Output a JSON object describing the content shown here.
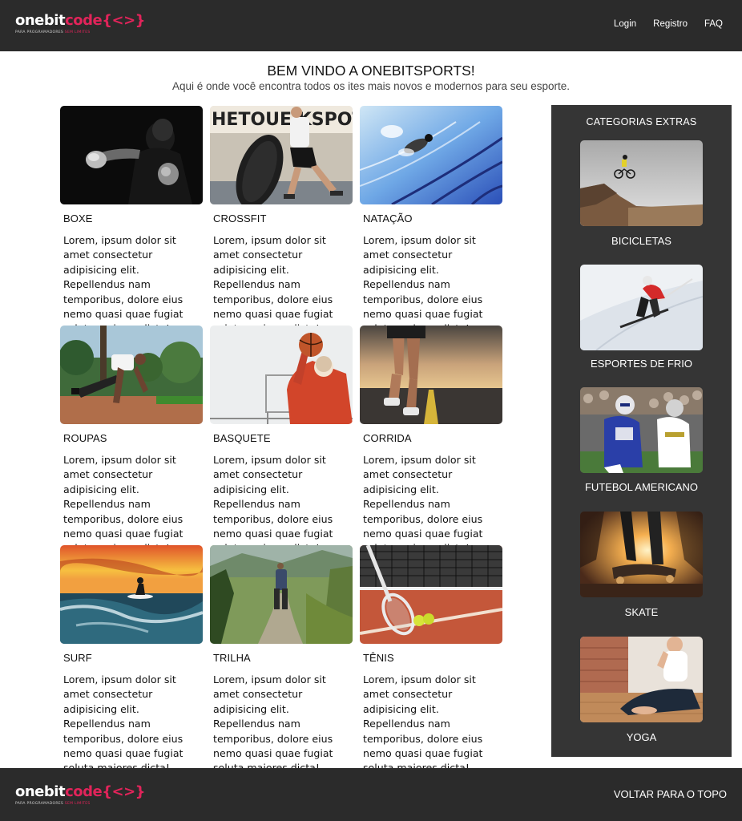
{
  "header": {
    "logo_text_white": "onebit",
    "logo_text_red": "code",
    "logo_braces": "{<>}",
    "logo_tagline": "PARA PROGRAMADORES",
    "logo_tagline_accent": "SEM LIMITES",
    "nav": [
      "Login",
      "Registro",
      "FAQ"
    ]
  },
  "hero": {
    "title": "BEM VINDO A ONEBITSPORTS!",
    "subtitle": "Aqui é onde você encontra todos os ites mais novos e modernos para seu esporte."
  },
  "cards": [
    {
      "title": "BOXE",
      "text": "Lorem, ipsum dolor sit amet consectetur adipisicing elit. Repellendus nam temporibus, dolore eius nemo quasi quae fugiat soluta maiores dicta!",
      "icon": "boxing-photo"
    },
    {
      "title": "CROSSFIT",
      "text": "Lorem, ipsum dolor sit amet consectetur adipisicing elit. Repellendus nam temporibus, dolore eius nemo quasi quae fugiat soluta maiores dicta!",
      "icon": "crossfit-photo"
    },
    {
      "title": "NATAÇÃO",
      "text": "Lorem, ipsum dolor sit amet consectetur adipisicing elit. Repellendus nam temporibus, dolore eius nemo quasi quae fugiat soluta maiores dicta!",
      "icon": "swimming-photo"
    },
    {
      "title": "ROUPAS",
      "text": "Lorem, ipsum dolor sit amet consectetur adipisicing elit. Repellendus nam temporibus, dolore eius nemo quasi quae fugiat soluta maiores dicta!",
      "icon": "workout-photo"
    },
    {
      "title": "BASQUETE",
      "text": "Lorem, ipsum dolor sit amet consectetur adipisicing elit. Repellendus nam temporibus, dolore eius nemo quasi quae fugiat soluta maiores dicta!",
      "icon": "basketball-photo"
    },
    {
      "title": "CORRIDA",
      "text": "Lorem, ipsum dolor sit amet consectetur adipisicing elit. Repellendus nam temporibus, dolore eius nemo quasi quae fugiat soluta maiores dicta!",
      "icon": "running-photo"
    },
    {
      "title": "SURF",
      "text": "Lorem, ipsum dolor sit amet consectetur adipisicing elit. Repellendus nam temporibus, dolore eius nemo quasi quae fugiat soluta maiores dicta!",
      "icon": "surf-photo"
    },
    {
      "title": "TRILHA",
      "text": "Lorem, ipsum dolor sit amet consectetur adipisicing elit. Repellendus nam temporibus, dolore eius nemo quasi quae fugiat soluta maiores dicta!",
      "icon": "hiking-photo"
    },
    {
      "title": "TÊNIS",
      "text": "Lorem, ipsum dolor sit amet consectetur adipisicing elit. Repellendus nam temporibus, dolore eius nemo quasi quae fugiat soluta maiores dicta!",
      "icon": "tennis-photo"
    }
  ],
  "sidebar": {
    "title": "CATEGORIAS EXTRAS",
    "items": [
      {
        "label": "BICICLETAS",
        "icon": "bicycle-photo"
      },
      {
        "label": "ESPORTES DE FRIO",
        "icon": "ski-photo"
      },
      {
        "label": "FUTEBOL AMERICANO",
        "icon": "football-photo"
      },
      {
        "label": "SKATE",
        "icon": "skate-photo"
      },
      {
        "label": "YOGA",
        "icon": "yoga-photo"
      }
    ]
  },
  "footer": {
    "back_to_top": "VOLTAR PARA O TOPO"
  },
  "colors": {
    "header_bg": "#2b2b2b",
    "sidebar_bg": "#353535",
    "brand_accent": "#e1245a"
  }
}
